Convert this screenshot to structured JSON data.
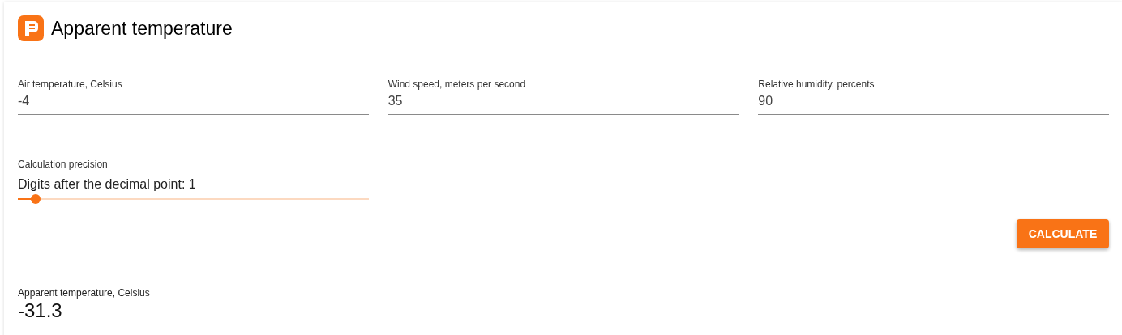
{
  "title": "Apparent temperature",
  "fields": [
    {
      "label": "Air temperature, Celsius",
      "value": "-4"
    },
    {
      "label": "Wind speed, meters per second",
      "value": "35"
    },
    {
      "label": "Relative humidity, percents",
      "value": "90"
    }
  ],
  "precision": {
    "label": "Calculation precision",
    "text": "Digits after the decimal point: 1",
    "level": 0.05
  },
  "button": "CALCULATE",
  "result": {
    "label": "Apparent temperature, Celsius",
    "value": "-31.3"
  }
}
